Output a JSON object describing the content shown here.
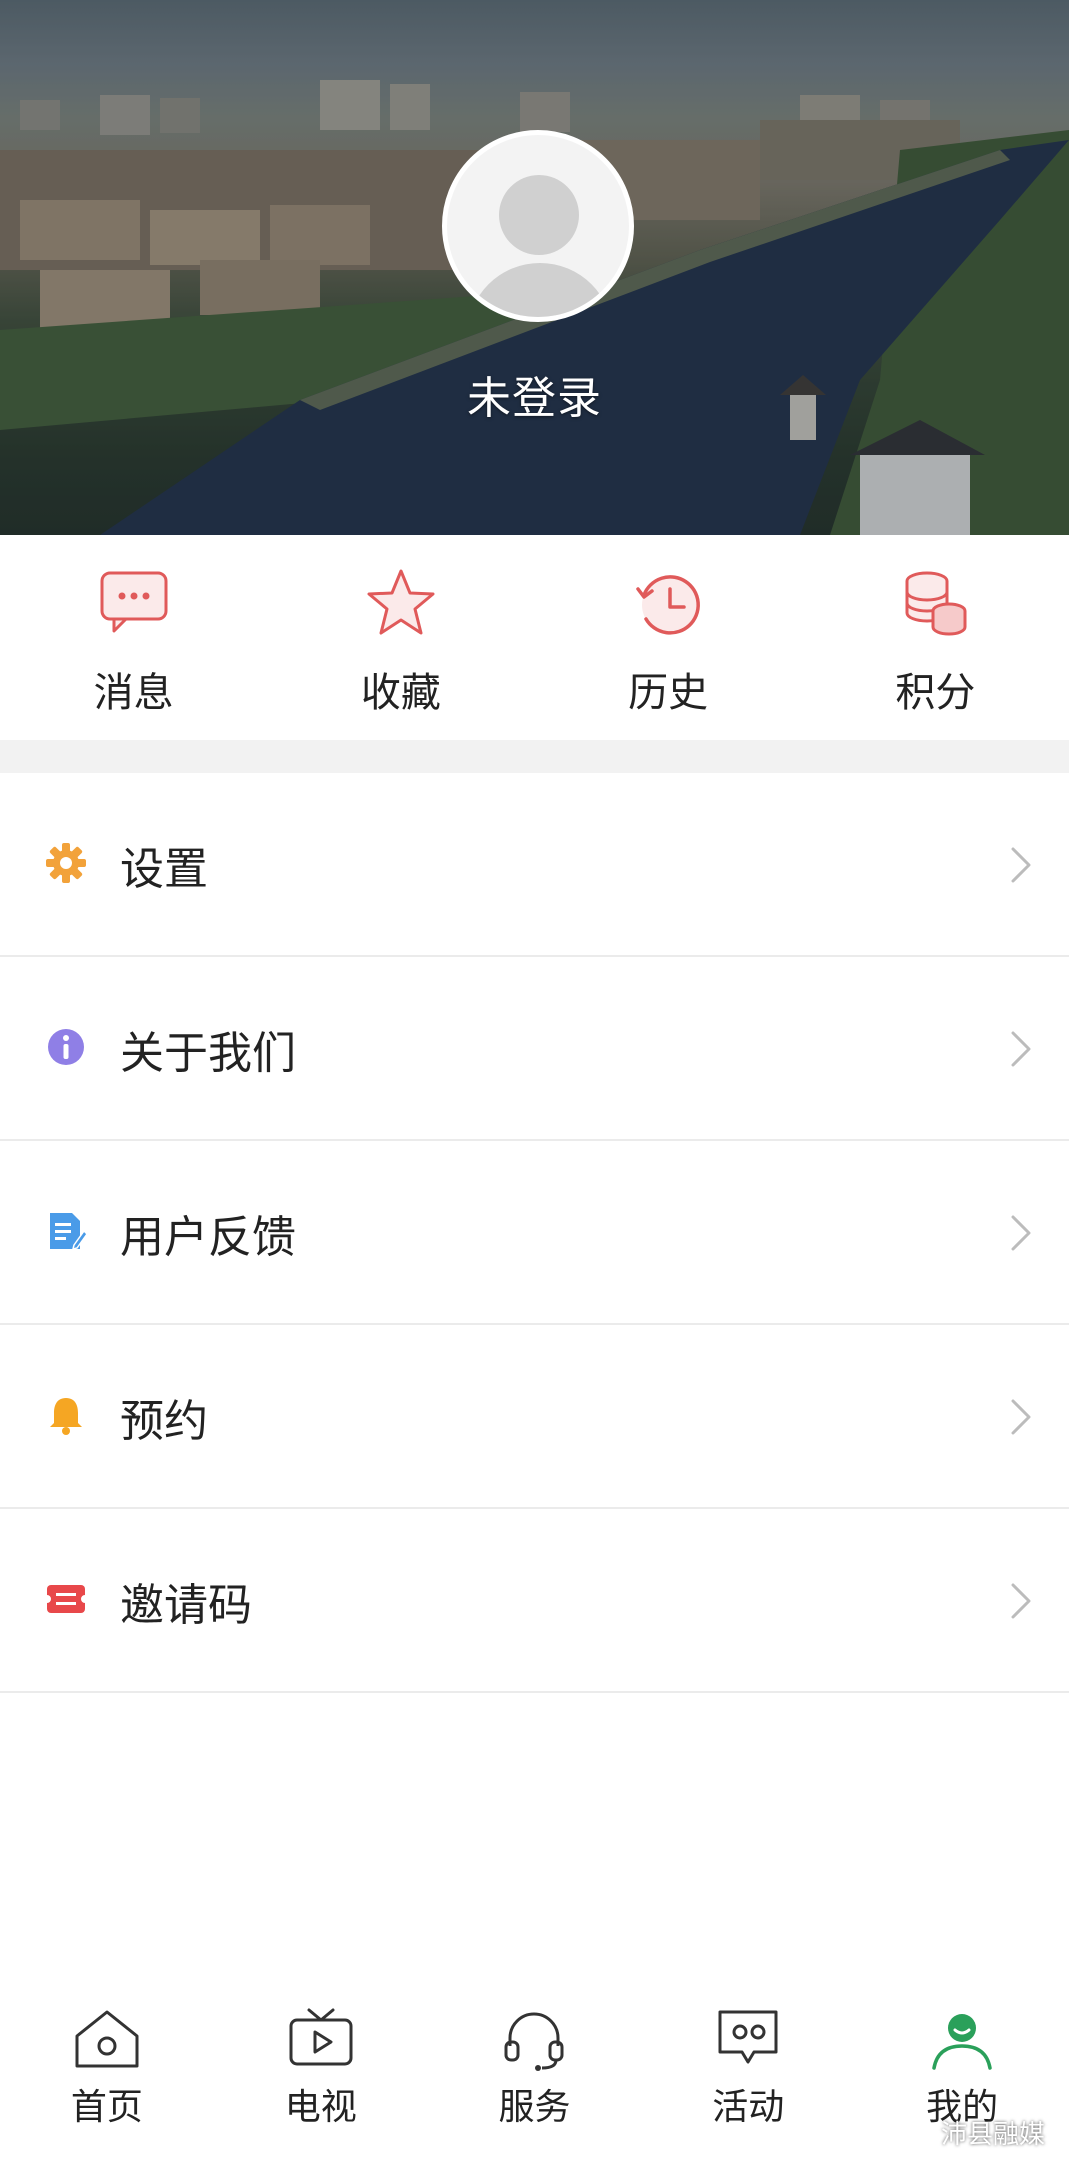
{
  "profile": {
    "login_status": "未登录"
  },
  "quick_actions": [
    {
      "label": "消息",
      "icon": "message-icon"
    },
    {
      "label": "收藏",
      "icon": "star-icon"
    },
    {
      "label": "历史",
      "icon": "history-icon"
    },
    {
      "label": "积分",
      "icon": "coins-icon"
    }
  ],
  "menu": [
    {
      "label": "设置",
      "icon": "gear-icon",
      "color": "#f2a23a"
    },
    {
      "label": "关于我们",
      "icon": "info-icon",
      "color": "#8f7fe6"
    },
    {
      "label": "用户反馈",
      "icon": "document-icon",
      "color": "#4a9be8"
    },
    {
      "label": "预约",
      "icon": "bell-icon",
      "color": "#f5a623"
    },
    {
      "label": "邀请码",
      "icon": "ticket-icon",
      "color": "#e8484a"
    }
  ],
  "tabs": [
    {
      "label": "首页",
      "icon": "home-icon"
    },
    {
      "label": "电视",
      "icon": "tv-icon"
    },
    {
      "label": "服务",
      "icon": "headset-icon"
    },
    {
      "label": "活动",
      "icon": "chat-icon"
    },
    {
      "label": "我的",
      "icon": "user-icon",
      "active": true
    }
  ],
  "watermark": "沛县融媒",
  "colors": {
    "accent_red": "#e05a5a",
    "active_tab": "#2aa05a"
  }
}
